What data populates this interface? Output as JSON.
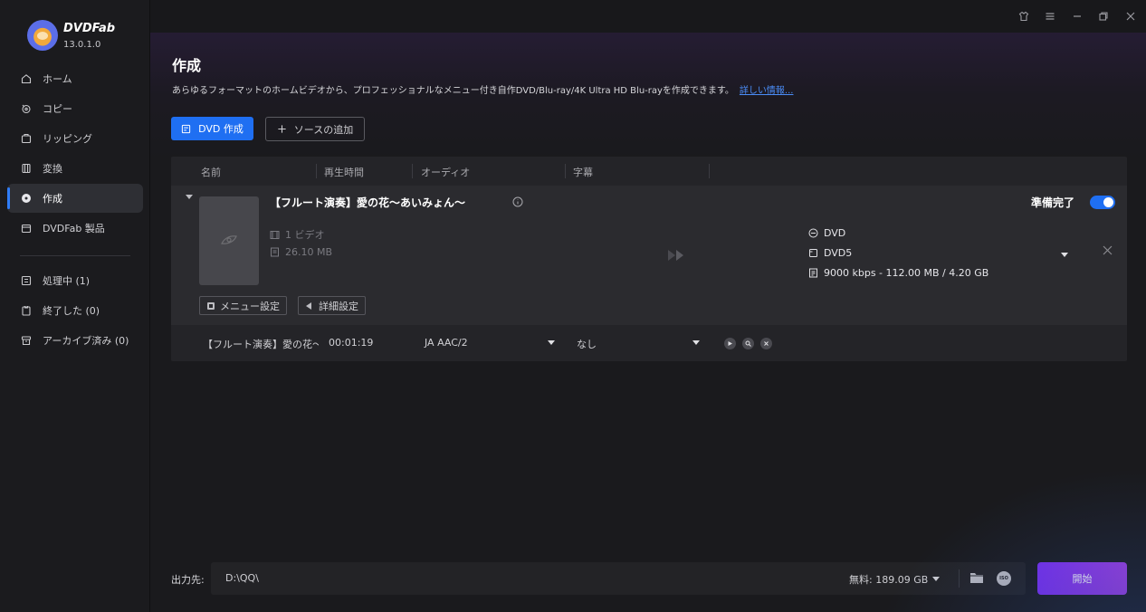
{
  "app": {
    "brand": "DVDFab",
    "version": "13.0.1.0"
  },
  "sidebar": {
    "items": [
      {
        "label": "ホーム",
        "icon": "home-icon"
      },
      {
        "label": "コピー",
        "icon": "copy-icon"
      },
      {
        "label": "リッピング",
        "icon": "ripper-icon"
      },
      {
        "label": "変換",
        "icon": "convert-icon"
      },
      {
        "label": "作成",
        "icon": "creator-icon",
        "active": true
      },
      {
        "label": "DVDFab 製品",
        "icon": "products-icon"
      }
    ],
    "queue": [
      {
        "label": "処理中 (1)",
        "icon": "processing-icon"
      },
      {
        "label": "終了した (0)",
        "icon": "finished-icon"
      },
      {
        "label": "アーカイブ済み (0)",
        "icon": "archive-icon"
      }
    ]
  },
  "window": {
    "icons": [
      "skin-icon",
      "menu-icon",
      "minimize-icon",
      "restore-icon",
      "close-icon"
    ]
  },
  "main": {
    "title": "作成",
    "description": "あらゆるフォーマットのホームビデオから、プロフェッショナルなメニュー付き自作DVD/Blu-ray/4K Ultra HD Blu-rayを作成できます。",
    "more_link": "詳しい情報...",
    "dvd_create_button": "DVD 作成",
    "add_source_button": "ソースの追加"
  },
  "table": {
    "headers": [
      "名前",
      "再生時間",
      "オーディオ",
      "字幕"
    ],
    "item": {
      "title": "【フルート演奏】愛の花〜あいみょん〜",
      "video_count": "1 ビデオ",
      "size": "26.10 MB",
      "ready_label": "準備完了",
      "ready_enabled": true,
      "output_format": "DVD",
      "disc_type": "DVD5",
      "bitrate_info": "9000 kbps - 112.00 MB / 4.20 GB",
      "menu_settings_button": "メニュー設定",
      "advanced_settings_button": "詳細設定"
    },
    "sub_row": {
      "name": "【フルート演奏】愛の花〜",
      "duration": "00:01:19",
      "audio": "JA  AAC/2",
      "subtitle": "なし"
    }
  },
  "bottom": {
    "output_label": "出力先:",
    "output_path": "D:\\QQ\\",
    "free_space": "無料: 189.09 GB",
    "iso_text": "ISO",
    "start_button": "開始"
  },
  "colors": {
    "accent": "#1f6ff2",
    "start_gradient_from": "#7b2ff7",
    "start_gradient_to": "#a13ee8",
    "link": "#4a8cf7"
  }
}
